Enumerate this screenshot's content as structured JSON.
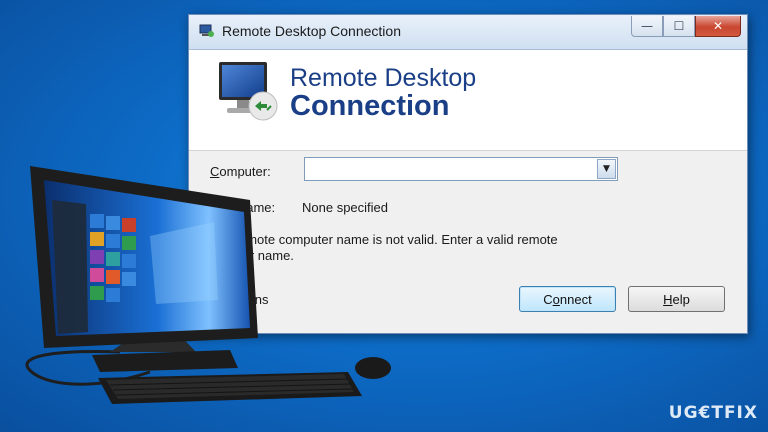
{
  "window": {
    "title": "Remote Desktop Connection",
    "controls": {
      "minimize": "—",
      "maximize": "☐",
      "close": "✕"
    }
  },
  "banner": {
    "line1": "Remote Desktop",
    "line2": "Connection"
  },
  "form": {
    "computer_label_first": "C",
    "computer_label_rest": "omputer:",
    "computer_value": "",
    "dropdown_glyph": "▼",
    "username_label": "name:",
    "username_value": "None specified",
    "error_line1": "emote computer name is not valid. Enter a valid remote",
    "error_line2": "ter name.",
    "options_label": "tions"
  },
  "buttons": {
    "connect_first": "C",
    "connect_under": "o",
    "connect_rest": "nnect",
    "help_first": "H",
    "help_rest": "elp"
  },
  "colors": {
    "background": "#0d6cc7",
    "banner_text": "#1a3f86",
    "close_button": "#c8462f"
  },
  "watermark": {
    "text": "UG€TFIX"
  }
}
